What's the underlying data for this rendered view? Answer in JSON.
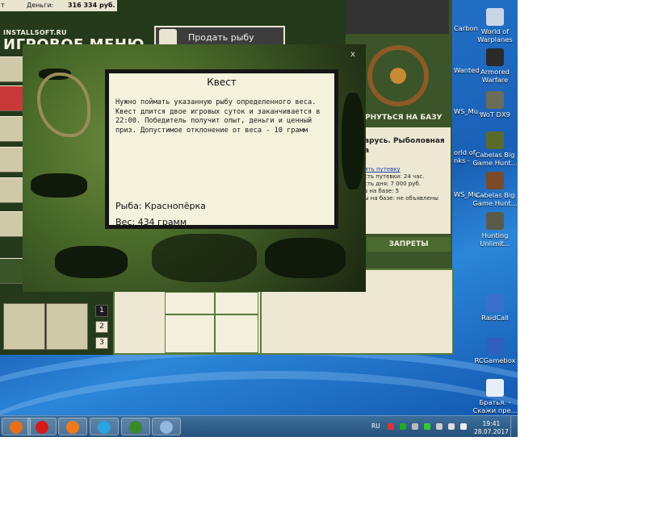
{
  "game": {
    "money_label": "Деньги:",
    "money_value": "316 334 руб.",
    "cut_label": "т",
    "logo_small": "INSTALLSOFT.RU",
    "logo_big": "ИГРОВОЕ МЕНЮ",
    "sell_fish": "Продать рыбу",
    "return_to_base": "РНУТЬСЯ НА БАЗУ",
    "close": "x",
    "rules_tab": "ЗАПРЕТЫ",
    "pages": [
      "1",
      "2",
      "3"
    ],
    "base_info": {
      "title_line1": "арусь. Рыболовная",
      "title_line2": "а",
      "link": "ить путевку",
      "lines": [
        "сть путевки: 24 час.",
        "сть дня: 7 000 руб.",
        "в на базе: 5",
        "ы на базе: не объявлены"
      ]
    }
  },
  "quest": {
    "title": "Квест",
    "description": "Нужно поймать указанную рыбу определенного веса. Квест длится двое игровых суток и заканчивается в 22:00. Победитель получит опыт, деньги и ценный приз. Допустимое отклонение от веса - 10 грамм",
    "fish": "Рыба: Краснопёрка",
    "weight": "Вес: 434 грамм"
  },
  "desktop": {
    "clipped_labels": [
      "Carbon",
      "Wanted",
      "WS_Mu...",
      "orld of",
      "nks - ...",
      "WS_Mu..."
    ],
    "icons": [
      {
        "name": "world-of-warplanes",
        "label1": "World of",
        "label2": "Warplanes",
        "color": "#c9d6e6"
      },
      {
        "name": "armored-warfare",
        "label1": "Armored",
        "label2": "Warfare",
        "color": "#2a2a2a"
      },
      {
        "name": "wot-dx9",
        "label1": "WoT DX9",
        "label2": "",
        "color": "#6b6b5a"
      },
      {
        "name": "cabelas-big-game-hunt-1",
        "label1": "Cabelas Big",
        "label2": "Game Hunt...",
        "color": "#5a6a2a"
      },
      {
        "name": "cabelas-big-game-hunt-2",
        "label1": "Cabelas Big",
        "label2": "Game Hunt...",
        "color": "#7a4a2a"
      },
      {
        "name": "hunting-unlimited",
        "label1": "Hunting",
        "label2": "Unlimit...",
        "color": "#5a5a4a"
      },
      {
        "name": "raidcall",
        "label1": "RaidCall",
        "label2": "",
        "color": "#3a6fd0"
      },
      {
        "name": "rcgamebox",
        "label1": "RCGamebox",
        "label2": "",
        "color": "#2f5fc0"
      },
      {
        "name": "bratya-skazhi",
        "label1": "Братья. -",
        "label2": "Скажи пре...",
        "color": "#e8eef8"
      }
    ]
  },
  "taskbar": {
    "language": "RU",
    "time": "19:41",
    "date": "28.07.2017",
    "apps": [
      {
        "name": "firefox",
        "color": "#e8701a"
      },
      {
        "name": "opera",
        "color": "#d61a1a"
      },
      {
        "name": "origin",
        "color": "#f07a1a"
      },
      {
        "name": "skype",
        "color": "#2aa3e0"
      },
      {
        "name": "game-butterfly",
        "color": "#3a8a2a"
      },
      {
        "name": "paint",
        "color": "#8fb7df"
      }
    ]
  }
}
